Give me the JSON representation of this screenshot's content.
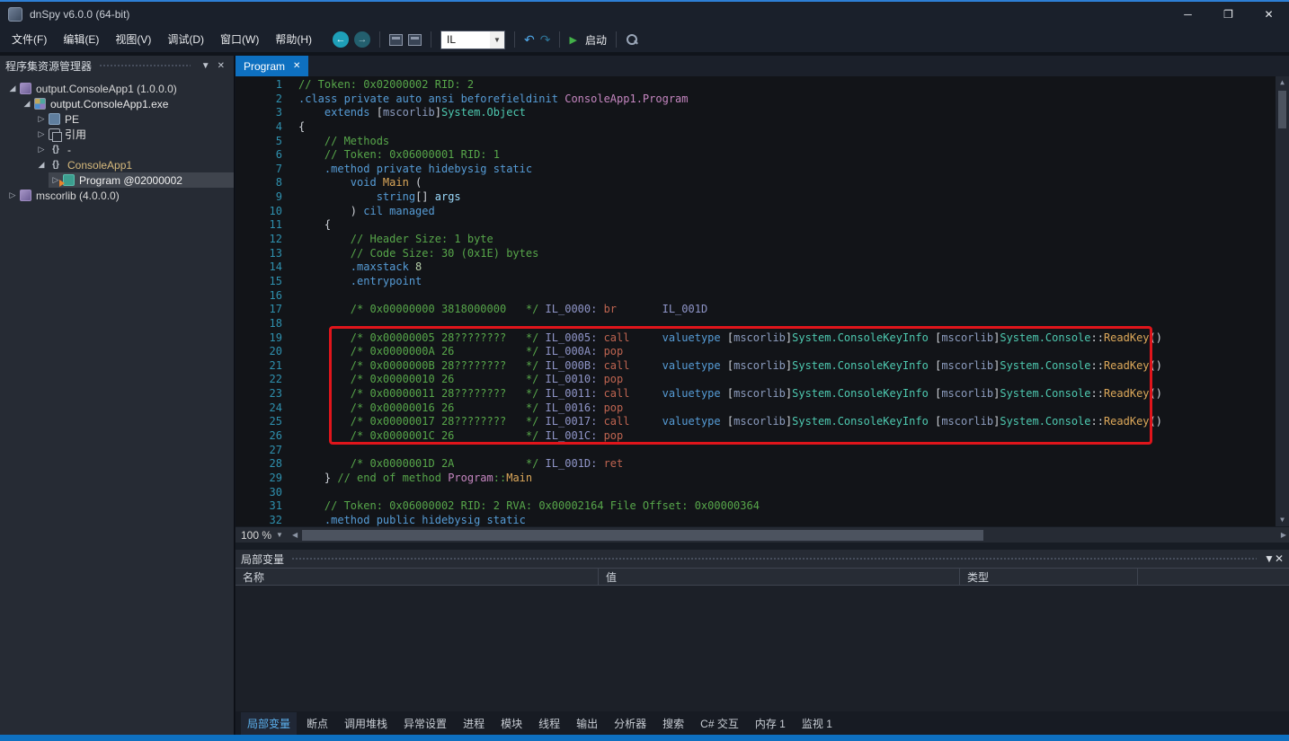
{
  "colors": {
    "accent": "#0E70C0",
    "annotation": "#E0151B",
    "namespace_gold": "#D7BA7D",
    "syntax": {
      "cmt": "#57A64A",
      "kw": "#569CD6",
      "type": "#4EC9B0",
      "vio": "#C586C0",
      "meth": "#DCA85A",
      "lbl": "#8F95C8",
      "op": "#BE6450",
      "num": "#B5CEA8",
      "pnc": "#D0D4DA",
      "pln": "#C8CCD4",
      "asm": "#8C9CBE",
      "param": "#9CDCFE"
    }
  },
  "titlebar": {
    "title": "dnSpy v6.0.0 (64-bit)",
    "minimize_icon": "─",
    "maximize_icon": "❐",
    "close_icon": "✕"
  },
  "menu": {
    "items": [
      "文件(F)",
      "编辑(E)",
      "视图(V)",
      "调试(D)",
      "窗口(W)",
      "帮助(H)"
    ]
  },
  "toolbar": {
    "back_icon": "←",
    "forward_icon": "→",
    "language_value": "IL",
    "dropdown_icon": "▼",
    "undo_icon": "↶",
    "redo_icon": "↷",
    "play_icon": "▶",
    "start_label": "启动"
  },
  "explorer": {
    "title": "程序集资源管理器",
    "menu_icon": "▼",
    "close_icon": "✕",
    "expanded_glyph": "◢",
    "collapsed_glyph": "▷",
    "nodes": [
      {
        "depth": 0,
        "exp": "open",
        "icon": "assembly",
        "label": "output.ConsoleApp1 (1.0.0.0)",
        "color": "#D8D8D8",
        "selected": false
      },
      {
        "depth": 1,
        "exp": "open",
        "icon": "module",
        "label": "output.ConsoleApp1.exe",
        "color": "#E8E8E8",
        "selected": false
      },
      {
        "depth": 2,
        "exp": "closed",
        "icon": "pe",
        "label": "PE",
        "color": "#E0E0E0",
        "selected": false
      },
      {
        "depth": 2,
        "exp": "closed",
        "icon": "ref",
        "label": "引用",
        "color": "#E0E0E0",
        "selected": false
      },
      {
        "depth": 2,
        "exp": "closed",
        "icon": "ns",
        "label": "-",
        "color": "#E0E0E0",
        "selected": false
      },
      {
        "depth": 2,
        "exp": "open",
        "icon": "ns",
        "label": "ConsoleApp1",
        "color": "#D7BA7D",
        "selected": false
      },
      {
        "depth": 3,
        "exp": "closed",
        "icon": "class",
        "label": "Program @02000002",
        "color": "#F0F0F0",
        "selected": true
      },
      {
        "depth": 0,
        "exp": "closed",
        "icon": "assembly",
        "label": "mscorlib (4.0.0.0)",
        "color": "#D8D8D8",
        "selected": false
      }
    ]
  },
  "editor": {
    "tab_label": "Program",
    "tab_close_icon": "✕",
    "zoom": "100 %",
    "lines": [
      {
        "n": 1,
        "s": [
          [
            "cmt",
            "// Token: 0x02000002 RID: 2"
          ]
        ]
      },
      {
        "n": 2,
        "s": [
          [
            "kw",
            ".class private auto ansi beforefieldinit "
          ],
          [
            "vio",
            "ConsoleApp1.Program"
          ]
        ]
      },
      {
        "n": 3,
        "s": [
          [
            "pln",
            "    "
          ],
          [
            "kw",
            "extends "
          ],
          [
            "pnc",
            "["
          ],
          [
            "asm",
            "mscorlib"
          ],
          [
            "pnc",
            "]"
          ],
          [
            "type",
            "System.Object"
          ]
        ]
      },
      {
        "n": 4,
        "s": [
          [
            "pnc",
            "{"
          ]
        ]
      },
      {
        "n": 5,
        "s": [
          [
            "pln",
            "    "
          ],
          [
            "cmt",
            "// Methods"
          ]
        ]
      },
      {
        "n": 6,
        "s": [
          [
            "pln",
            "    "
          ],
          [
            "cmt",
            "// Token: 0x06000001 RID: 1"
          ]
        ]
      },
      {
        "n": 7,
        "s": [
          [
            "pln",
            "    "
          ],
          [
            "kw",
            ".method private hidebysig static"
          ]
        ]
      },
      {
        "n": 8,
        "s": [
          [
            "pln",
            "        "
          ],
          [
            "kw",
            "void "
          ],
          [
            "meth",
            "Main"
          ],
          [
            "pnc",
            " ("
          ]
        ]
      },
      {
        "n": 9,
        "s": [
          [
            "pln",
            "            "
          ],
          [
            "kw",
            "string"
          ],
          [
            "pnc",
            "[] "
          ],
          [
            "param",
            "args"
          ]
        ]
      },
      {
        "n": 10,
        "s": [
          [
            "pln",
            "        "
          ],
          [
            "pnc",
            ") "
          ],
          [
            "kw",
            "cil managed"
          ]
        ]
      },
      {
        "n": 11,
        "s": [
          [
            "pln",
            "    "
          ],
          [
            "pnc",
            "{"
          ]
        ]
      },
      {
        "n": 12,
        "s": [
          [
            "pln",
            "        "
          ],
          [
            "cmt",
            "// Header Size: 1 byte"
          ]
        ]
      },
      {
        "n": 13,
        "s": [
          [
            "pln",
            "        "
          ],
          [
            "cmt",
            "// Code Size: 30 (0x1E) bytes"
          ]
        ]
      },
      {
        "n": 14,
        "s": [
          [
            "pln",
            "        "
          ],
          [
            "kw",
            ".maxstack "
          ],
          [
            "num",
            "8"
          ]
        ]
      },
      {
        "n": 15,
        "s": [
          [
            "pln",
            "        "
          ],
          [
            "kw",
            ".entrypoint"
          ]
        ]
      },
      {
        "n": 16,
        "s": []
      },
      {
        "n": 17,
        "s": [
          [
            "pln",
            "        "
          ],
          [
            "cmt",
            "/* 0x00000000 3818000000   */"
          ],
          [
            "pln",
            " "
          ],
          [
            "lbl",
            "IL_0000:"
          ],
          [
            "pln",
            " "
          ],
          [
            "op",
            "br"
          ],
          [
            "pln",
            "       "
          ],
          [
            "lbl",
            "IL_001D"
          ]
        ]
      },
      {
        "n": 18,
        "s": []
      },
      {
        "n": 19,
        "s": [
          [
            "pln",
            "        "
          ],
          [
            "cmt",
            "/* 0x00000005 28????????   */"
          ],
          [
            "pln",
            " "
          ],
          [
            "lbl",
            "IL_0005:"
          ],
          [
            "pln",
            " "
          ],
          [
            "op",
            "call"
          ],
          [
            "pln",
            "     "
          ],
          [
            "kw",
            "valuetype "
          ],
          [
            "pnc",
            "["
          ],
          [
            "asm",
            "mscorlib"
          ],
          [
            "pnc",
            "]"
          ],
          [
            "type",
            "System.ConsoleKeyInfo"
          ],
          [
            "pln",
            " "
          ],
          [
            "pnc",
            "["
          ],
          [
            "asm",
            "mscorlib"
          ],
          [
            "pnc",
            "]"
          ],
          [
            "type",
            "System.Console"
          ],
          [
            "pnc",
            "::"
          ],
          [
            "meth",
            "ReadKey"
          ],
          [
            "pnc",
            "()"
          ]
        ]
      },
      {
        "n": 20,
        "s": [
          [
            "pln",
            "        "
          ],
          [
            "cmt",
            "/* 0x0000000A 26           */"
          ],
          [
            "pln",
            " "
          ],
          [
            "lbl",
            "IL_000A:"
          ],
          [
            "pln",
            " "
          ],
          [
            "op",
            "pop"
          ]
        ]
      },
      {
        "n": 21,
        "s": [
          [
            "pln",
            "        "
          ],
          [
            "cmt",
            "/* 0x0000000B 28????????   */"
          ],
          [
            "pln",
            " "
          ],
          [
            "lbl",
            "IL_000B:"
          ],
          [
            "pln",
            " "
          ],
          [
            "op",
            "call"
          ],
          [
            "pln",
            "     "
          ],
          [
            "kw",
            "valuetype "
          ],
          [
            "pnc",
            "["
          ],
          [
            "asm",
            "mscorlib"
          ],
          [
            "pnc",
            "]"
          ],
          [
            "type",
            "System.ConsoleKeyInfo"
          ],
          [
            "pln",
            " "
          ],
          [
            "pnc",
            "["
          ],
          [
            "asm",
            "mscorlib"
          ],
          [
            "pnc",
            "]"
          ],
          [
            "type",
            "System.Console"
          ],
          [
            "pnc",
            "::"
          ],
          [
            "meth",
            "ReadKey"
          ],
          [
            "pnc",
            "()"
          ]
        ]
      },
      {
        "n": 22,
        "s": [
          [
            "pln",
            "        "
          ],
          [
            "cmt",
            "/* 0x00000010 26           */"
          ],
          [
            "pln",
            " "
          ],
          [
            "lbl",
            "IL_0010:"
          ],
          [
            "pln",
            " "
          ],
          [
            "op",
            "pop"
          ]
        ]
      },
      {
        "n": 23,
        "s": [
          [
            "pln",
            "        "
          ],
          [
            "cmt",
            "/* 0x00000011 28????????   */"
          ],
          [
            "pln",
            " "
          ],
          [
            "lbl",
            "IL_0011:"
          ],
          [
            "pln",
            " "
          ],
          [
            "op",
            "call"
          ],
          [
            "pln",
            "     "
          ],
          [
            "kw",
            "valuetype "
          ],
          [
            "pnc",
            "["
          ],
          [
            "asm",
            "mscorlib"
          ],
          [
            "pnc",
            "]"
          ],
          [
            "type",
            "System.ConsoleKeyInfo"
          ],
          [
            "pln",
            " "
          ],
          [
            "pnc",
            "["
          ],
          [
            "asm",
            "mscorlib"
          ],
          [
            "pnc",
            "]"
          ],
          [
            "type",
            "System.Console"
          ],
          [
            "pnc",
            "::"
          ],
          [
            "meth",
            "ReadKey"
          ],
          [
            "pnc",
            "()"
          ]
        ]
      },
      {
        "n": 24,
        "s": [
          [
            "pln",
            "        "
          ],
          [
            "cmt",
            "/* 0x00000016 26           */"
          ],
          [
            "pln",
            " "
          ],
          [
            "lbl",
            "IL_0016:"
          ],
          [
            "pln",
            " "
          ],
          [
            "op",
            "pop"
          ]
        ]
      },
      {
        "n": 25,
        "s": [
          [
            "pln",
            "        "
          ],
          [
            "cmt",
            "/* 0x00000017 28????????   */"
          ],
          [
            "pln",
            " "
          ],
          [
            "lbl",
            "IL_0017:"
          ],
          [
            "pln",
            " "
          ],
          [
            "op",
            "call"
          ],
          [
            "pln",
            "     "
          ],
          [
            "kw",
            "valuetype "
          ],
          [
            "pnc",
            "["
          ],
          [
            "asm",
            "mscorlib"
          ],
          [
            "pnc",
            "]"
          ],
          [
            "type",
            "System.ConsoleKeyInfo"
          ],
          [
            "pln",
            " "
          ],
          [
            "pnc",
            "["
          ],
          [
            "asm",
            "mscorlib"
          ],
          [
            "pnc",
            "]"
          ],
          [
            "type",
            "System.Console"
          ],
          [
            "pnc",
            "::"
          ],
          [
            "meth",
            "ReadKey"
          ],
          [
            "pnc",
            "()"
          ]
        ]
      },
      {
        "n": 26,
        "s": [
          [
            "pln",
            "        "
          ],
          [
            "cmt",
            "/* 0x0000001C 26           */"
          ],
          [
            "pln",
            " "
          ],
          [
            "lbl",
            "IL_001C:"
          ],
          [
            "pln",
            " "
          ],
          [
            "op",
            "pop"
          ]
        ]
      },
      {
        "n": 27,
        "s": []
      },
      {
        "n": 28,
        "s": [
          [
            "pln",
            "        "
          ],
          [
            "cmt",
            "/* 0x0000001D 2A           */"
          ],
          [
            "pln",
            " "
          ],
          [
            "lbl",
            "IL_001D:"
          ],
          [
            "pln",
            " "
          ],
          [
            "op",
            "ret"
          ]
        ]
      },
      {
        "n": 29,
        "s": [
          [
            "pln",
            "    "
          ],
          [
            "pnc",
            "} "
          ],
          [
            "cmt",
            "// end of method "
          ],
          [
            "vio",
            "Program"
          ],
          [
            "cmt",
            "::"
          ],
          [
            "meth",
            "Main"
          ]
        ]
      },
      {
        "n": 30,
        "s": []
      },
      {
        "n": 31,
        "s": [
          [
            "pln",
            "    "
          ],
          [
            "cmt",
            "// Token: 0x06000002 RID: 2 RVA: 0x00002164 File Offset: 0x00000364"
          ]
        ]
      },
      {
        "n": 32,
        "s": [
          [
            "pln",
            "    "
          ],
          [
            "kw",
            ".method public hidebysig static"
          ]
        ]
      }
    ]
  },
  "locals": {
    "title": "局部变量",
    "menu_icon": "▼",
    "close_icon": "✕",
    "columns": [
      "名称",
      "值",
      "类型"
    ],
    "rows": []
  },
  "bottom_tabs": {
    "active": "局部变量",
    "items": [
      "局部变量",
      "断点",
      "调用堆栈",
      "异常设置",
      "进程",
      "模块",
      "线程",
      "输出",
      "分析器",
      "搜索",
      "C# 交互",
      "内存 1",
      "监视 1"
    ]
  }
}
